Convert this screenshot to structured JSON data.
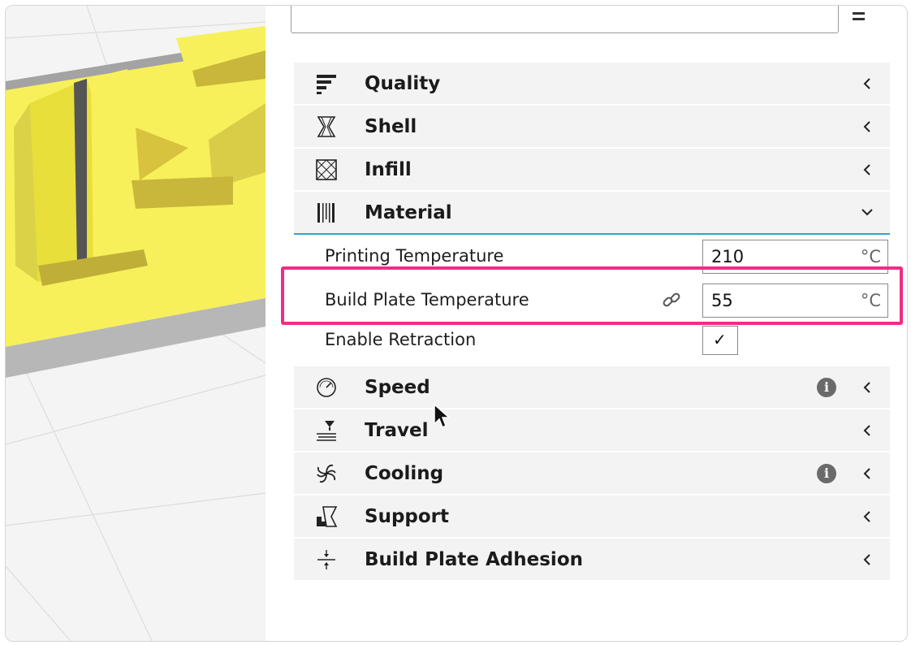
{
  "panel": {
    "categories_top": [
      {
        "id": "quality",
        "label": "Quality",
        "icon": "quality-icon"
      },
      {
        "id": "shell",
        "label": "Shell",
        "icon": "shell-icon"
      },
      {
        "id": "infill",
        "label": "Infill",
        "icon": "infill-icon"
      },
      {
        "id": "material",
        "label": "Material",
        "icon": "material-icon",
        "expanded": true
      }
    ],
    "material_settings": {
      "printing_temperature": {
        "label": "Printing Temperature",
        "value": "210",
        "unit": "°C"
      },
      "build_plate_temperature": {
        "label": "Build Plate Temperature",
        "value": "55",
        "unit": "°C"
      },
      "enable_retraction": {
        "label": "Enable Retraction",
        "checked": true,
        "mark": "✓"
      }
    },
    "categories_bottom": [
      {
        "id": "speed",
        "label": "Speed",
        "icon": "speedometer-icon",
        "info": "i"
      },
      {
        "id": "travel",
        "label": "Travel",
        "icon": "travel-icon"
      },
      {
        "id": "cooling",
        "label": "Cooling",
        "icon": "fan-icon",
        "info": "i"
      },
      {
        "id": "support",
        "label": "Support",
        "icon": "support-icon"
      },
      {
        "id": "adhesion",
        "label": "Build Plate Adhesion",
        "icon": "adhesion-icon"
      }
    ]
  },
  "colors": {
    "highlight": "#ee2e86",
    "accent": "#2aa6c9",
    "model": "#f7f05a"
  }
}
